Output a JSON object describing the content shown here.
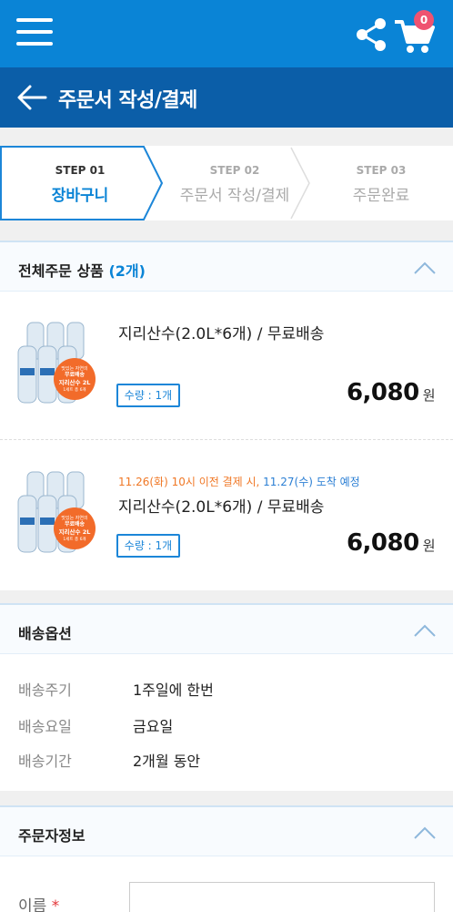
{
  "header": {
    "cart_count": "0",
    "icons": [
      "menu-icon",
      "share-icon",
      "cart-icon"
    ],
    "accent": "#0a84d6"
  },
  "titlebar": {
    "title": "주문서 작성/결제",
    "icon": "back-arrow-icon",
    "bg": "#0b5ea8"
  },
  "steps": [
    {
      "num": "STEP 01",
      "name": "장바구니",
      "active": true
    },
    {
      "num": "STEP 02",
      "name": "주문서 작성/결제",
      "active": false
    },
    {
      "num": "STEP 03",
      "name": "주문완료",
      "active": false
    }
  ],
  "order_items": {
    "title": "전체주문 상품",
    "count": "(2개)",
    "items": [
      {
        "name": "지리산수(2.0L*6개) / 무료배송",
        "qty": "수량 : 1개",
        "price": "6,080",
        "currency": "원",
        "delivery_note": null,
        "image_badge": [
          "맛있는 자연의",
          "무료배송",
          "지리산수 2L",
          "1세트 총 6개"
        ]
      },
      {
        "name": "지리산수(2.0L*6개) / 무료배송",
        "qty": "수량 : 1개",
        "price": "6,080",
        "currency": "원",
        "delivery_note": {
          "part1": "11.26(화) 10시 이전 결제 시, ",
          "part2": "11.27(수) 도착 예정"
        },
        "image_badge": [
          "맛있는 자연의",
          "무료배송",
          "지리산수 2L",
          "1세트 총 6개"
        ]
      }
    ]
  },
  "delivery_options": {
    "title": "배송옵션",
    "rows": [
      {
        "label": "배송주기",
        "value": "1주일에 한번"
      },
      {
        "label": "배송요일",
        "value": "금요일"
      },
      {
        "label": "배송기간",
        "value": "2개월 동안"
      }
    ]
  },
  "orderer": {
    "title": "주문자정보",
    "name_label": "이름",
    "required_mark": "*",
    "name_value": ""
  }
}
